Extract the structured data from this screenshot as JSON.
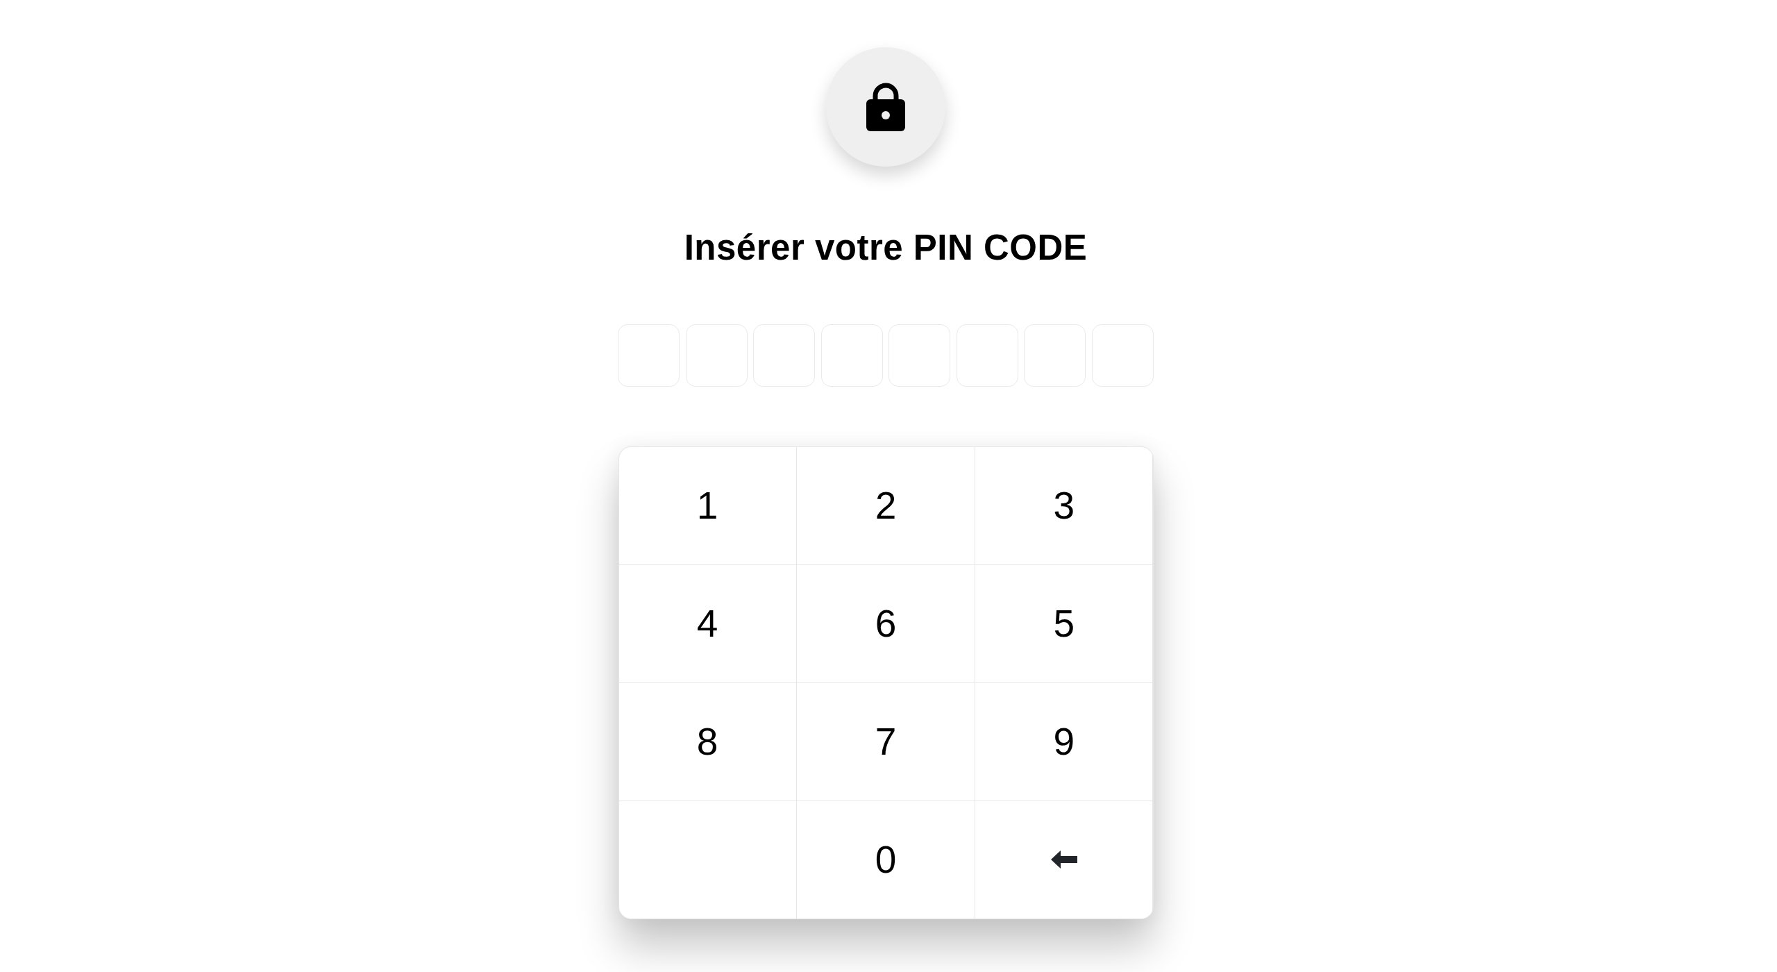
{
  "title": "Insérer votre PIN CODE",
  "pin_slots": [
    {
      "filled": false
    },
    {
      "filled": false
    },
    {
      "filled": false
    },
    {
      "filled": false
    },
    {
      "filled": false
    },
    {
      "filled": false
    },
    {
      "filled": false
    },
    {
      "filled": false
    }
  ],
  "keypad": [
    {
      "kind": "digit",
      "label": "1"
    },
    {
      "kind": "digit",
      "label": "2"
    },
    {
      "kind": "digit",
      "label": "3"
    },
    {
      "kind": "digit",
      "label": "4"
    },
    {
      "kind": "digit",
      "label": "6"
    },
    {
      "kind": "digit",
      "label": "5"
    },
    {
      "kind": "digit",
      "label": "8"
    },
    {
      "kind": "digit",
      "label": "7"
    },
    {
      "kind": "digit",
      "label": "9"
    },
    {
      "kind": "blank"
    },
    {
      "kind": "digit",
      "label": "0"
    },
    {
      "kind": "backspace"
    }
  ]
}
